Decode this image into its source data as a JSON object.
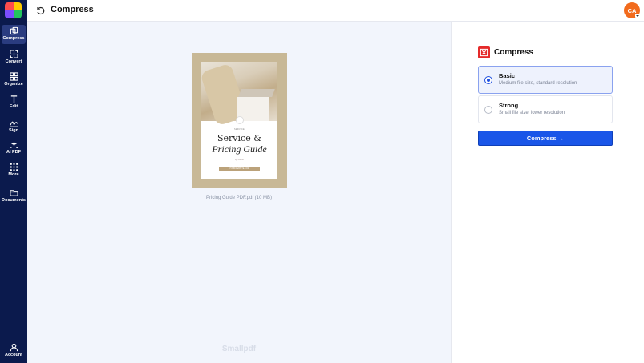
{
  "header": {
    "title": "Compress",
    "avatar_initials": "CA"
  },
  "sidebar": {
    "items": [
      {
        "label": "Compress",
        "icon": "compress-icon",
        "active": true
      },
      {
        "label": "Convert",
        "icon": "convert-icon"
      },
      {
        "label": "Organize",
        "icon": "organize-grid-icon"
      },
      {
        "label": "Edit",
        "icon": "text-edit-icon"
      },
      {
        "label": "Sign",
        "icon": "signature-icon"
      },
      {
        "label": "AI PDF",
        "icon": "sparkles-icon"
      },
      {
        "label": "More",
        "icon": "more-grid-icon"
      },
      {
        "label": "Documents",
        "icon": "folder-icon"
      }
    ],
    "account_label": "Account"
  },
  "preview": {
    "doc": {
      "small_top": "SERVICE",
      "title_line1": "Service &",
      "title_line2": "Pricing Guide",
      "signature": "by Studio",
      "bar_text": "YOURWEBSITE.COM"
    },
    "file_caption": "Pricing Guide PDF.pdf (10 MB)",
    "brand": "Smallpdf"
  },
  "panel": {
    "title": "Compress",
    "options": [
      {
        "name": "Basic",
        "desc": "Medium file size, standard resolution",
        "selected": true
      },
      {
        "name": "Strong",
        "desc": "Small file size, lower resolution",
        "selected": false
      }
    ],
    "button_label": "Compress →"
  },
  "colors": {
    "sidebar": "#0b1a4d",
    "accent": "#1a56e8",
    "tool": "#e52a2a",
    "avatar": "#f26b1d"
  }
}
